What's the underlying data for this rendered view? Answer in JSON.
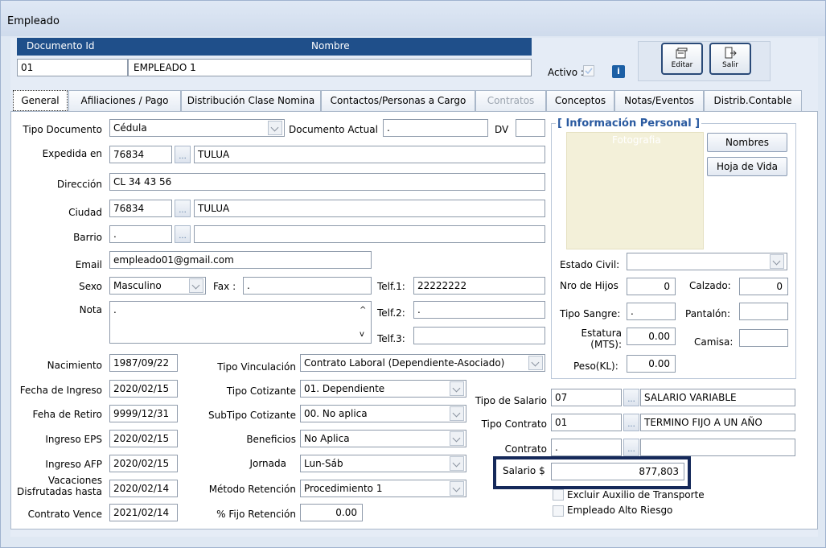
{
  "window_title": "Empleado",
  "header": {
    "col_documento": "Documento Id",
    "col_nombre": "Nombre",
    "documento_value": "01",
    "nombre_value": "EMPLEADO 1",
    "activo_label": "Activo :",
    "info_button": "i",
    "editar_label": "Editar",
    "salir_label": "Salir"
  },
  "tabs": [
    {
      "label": "General",
      "active": true
    },
    {
      "label": "Afiliaciones / Pago"
    },
    {
      "label": "Distribución Clase Nomina"
    },
    {
      "label": "Contactos/Personas a Cargo"
    },
    {
      "label": "Contratos",
      "disabled": true
    },
    {
      "label": "Conceptos"
    },
    {
      "label": "Notas/Eventos"
    },
    {
      "label": "Distrib.Contable"
    }
  ],
  "general": {
    "tipo_documento_label": "Tipo Documento",
    "tipo_documento_value": "Cédula",
    "documento_actual_label": "Documento Actual",
    "documento_actual_value": ".",
    "dv_label": "DV",
    "dv_value": "",
    "expedida_label": "Expedida en",
    "expedida_code": "76834",
    "expedida_city": "TULUA",
    "direccion_label": "Dirección",
    "direccion_value": "CL 34 43 56",
    "ciudad_label": "Ciudad",
    "ciudad_code": "76834",
    "ciudad_name": "TULUA",
    "barrio_label": "Barrio",
    "barrio_code": ".",
    "barrio_name": "",
    "email_label": "Email",
    "email_value": "empleado01@gmail.com",
    "sexo_label": "Sexo",
    "sexo_value": "Masculino",
    "fax_label": "Fax :",
    "fax_value": ".",
    "telf1_label": "Telf.1:",
    "telf1_value": "22222222",
    "telf2_label": "Telf.2:",
    "telf2_value": ".",
    "telf3_label": "Telf.3:",
    "telf3_value": "",
    "nota_label": "Nota",
    "nota_value": ".",
    "ellipsis": "...",
    "scroll_up": "^",
    "scroll_down": "v"
  },
  "dates": {
    "nacimiento_label": "Nacimiento",
    "nacimiento_value": "1987/09/22",
    "fecha_ingreso_label": "Fecha de Ingreso",
    "fecha_ingreso_value": "2020/02/15",
    "feha_retiro_label": "Feha de Retiro",
    "feha_retiro_value": "9999/12/31",
    "ingreso_eps_label": "Ingreso EPS",
    "ingreso_eps_value": "2020/02/15",
    "ingreso_afp_label": "Ingreso AFP",
    "ingreso_afp_value": "2020/02/15",
    "vacaciones_label_1": "Vacaciones",
    "vacaciones_label_2": "Disfrutadas hasta",
    "vacaciones_value": "2020/02/14",
    "contrato_vence_label": "Contrato Vence",
    "contrato_vence_value": "2021/02/14"
  },
  "vinculacion": {
    "tipo_vinculacion_label": "Tipo Vinculación",
    "tipo_vinculacion_value": "Contrato Laboral (Dependiente-Asociado)",
    "tipo_cotizante_label": "Tipo Cotizante",
    "tipo_cotizante_value": "01. Dependiente",
    "subtipo_cotizante_label": "SubTipo Cotizante",
    "subtipo_cotizante_value": "00. No aplica",
    "beneficios_label": "Beneficios",
    "beneficios_value": "No Aplica",
    "jornada_label": "Jornada",
    "jornada_value": "Lun-Sáb",
    "metodo_retencion_label": "Método Retención",
    "metodo_retencion_value": "Procedimiento 1",
    "fijo_retencion_label": "% Fijo Retención",
    "fijo_retencion_value": "0.00"
  },
  "salario": {
    "tipo_salario_label": "Tipo de Salario",
    "tipo_salario_code": "07",
    "tipo_salario_name": "SALARIO VARIABLE",
    "tipo_contrato_label": "Tipo Contrato",
    "tipo_contrato_code": "01",
    "tipo_contrato_name": "TERMINO FIJO A UN AÑO",
    "contrato_label": "Contrato",
    "contrato_code": ".",
    "contrato_name": "",
    "salario_label": "Salario $",
    "salario_value": "877,803",
    "excluir_label": "Excluir Auxilio de Transporte",
    "alto_riesgo_label": "Empleado Alto Riesgo"
  },
  "info_personal": {
    "title": "[ Información Personal ]",
    "fotografia": "Fotografia",
    "nombres_button": "Nombres",
    "hoja_vida_button": "Hoja de Vida",
    "estado_civil_label": "Estado Civil:",
    "estado_civil_value": "",
    "nro_hijos_label": "Nro de Hijos",
    "nro_hijos_value": "0",
    "calzado_label": "Calzado:",
    "calzado_value": "0",
    "tipo_sangre_label": "Tipo Sangre:",
    "tipo_sangre_value": ".",
    "pantalon_label": "Pantalón:",
    "pantalon_value": "",
    "estatura_label_1": "Estatura",
    "estatura_label_2": "(MTS):",
    "estatura_value": "0.00",
    "camisa_label": "Camisa:",
    "camisa_value": "",
    "peso_label": "Peso(KL):",
    "peso_value": "0.00"
  },
  "colors": {
    "header_bar": "#1f4f8a",
    "highlight": "#15295a",
    "section_title": "#2a5aa0"
  }
}
